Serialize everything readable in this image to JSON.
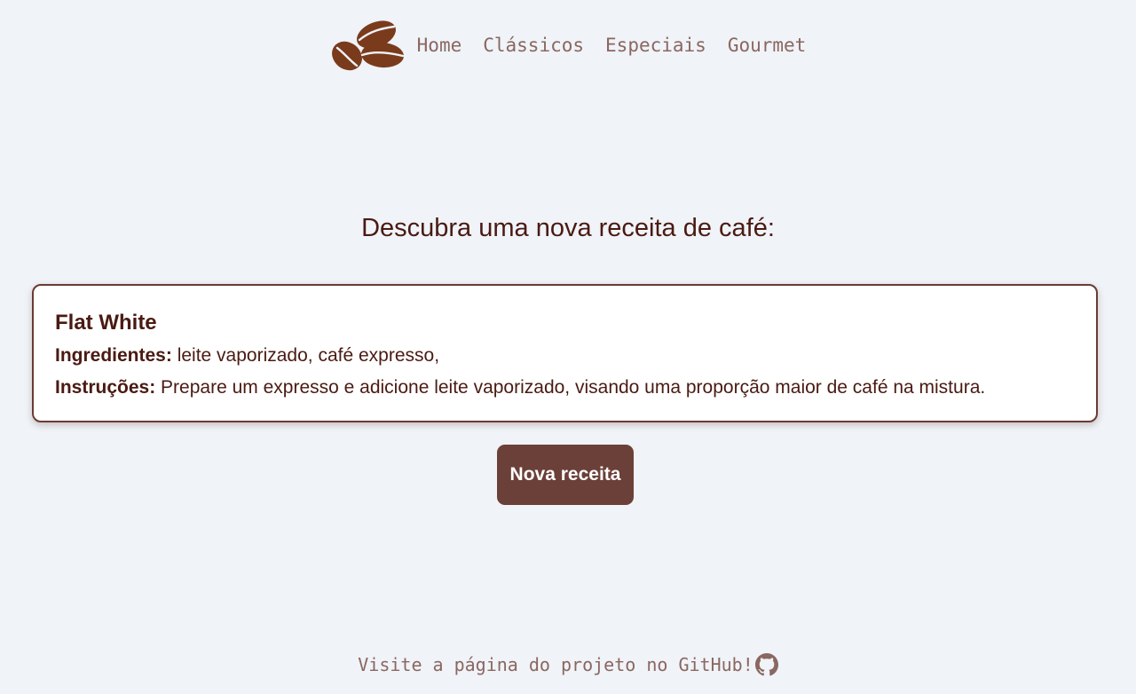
{
  "nav": {
    "logo_icon": "coffee-beans-icon",
    "links": [
      {
        "label": "Home"
      },
      {
        "label": "Clássicos"
      },
      {
        "label": "Especiais"
      },
      {
        "label": "Gourmet"
      }
    ]
  },
  "main": {
    "headline": "Descubra uma nova receita de café:",
    "recipe": {
      "name": "Flat White",
      "ingredients_label": "Ingredientes:",
      "ingredients": " leite vaporizado, café expresso,",
      "instructions_label": "Instruções:",
      "instructions": " Prepare um expresso e adicione leite vaporizado, visando uma proporção maior de café na mistura."
    },
    "new_recipe_button": "Nova receita"
  },
  "footer": {
    "text": "Visite a página do projeto no GitHub!",
    "icon": "github-icon"
  },
  "colors": {
    "background": "#f0f3f8",
    "brand_brown": "#6b4038",
    "text_dark": "#4a1a12",
    "nav_text": "#8a6760"
  }
}
